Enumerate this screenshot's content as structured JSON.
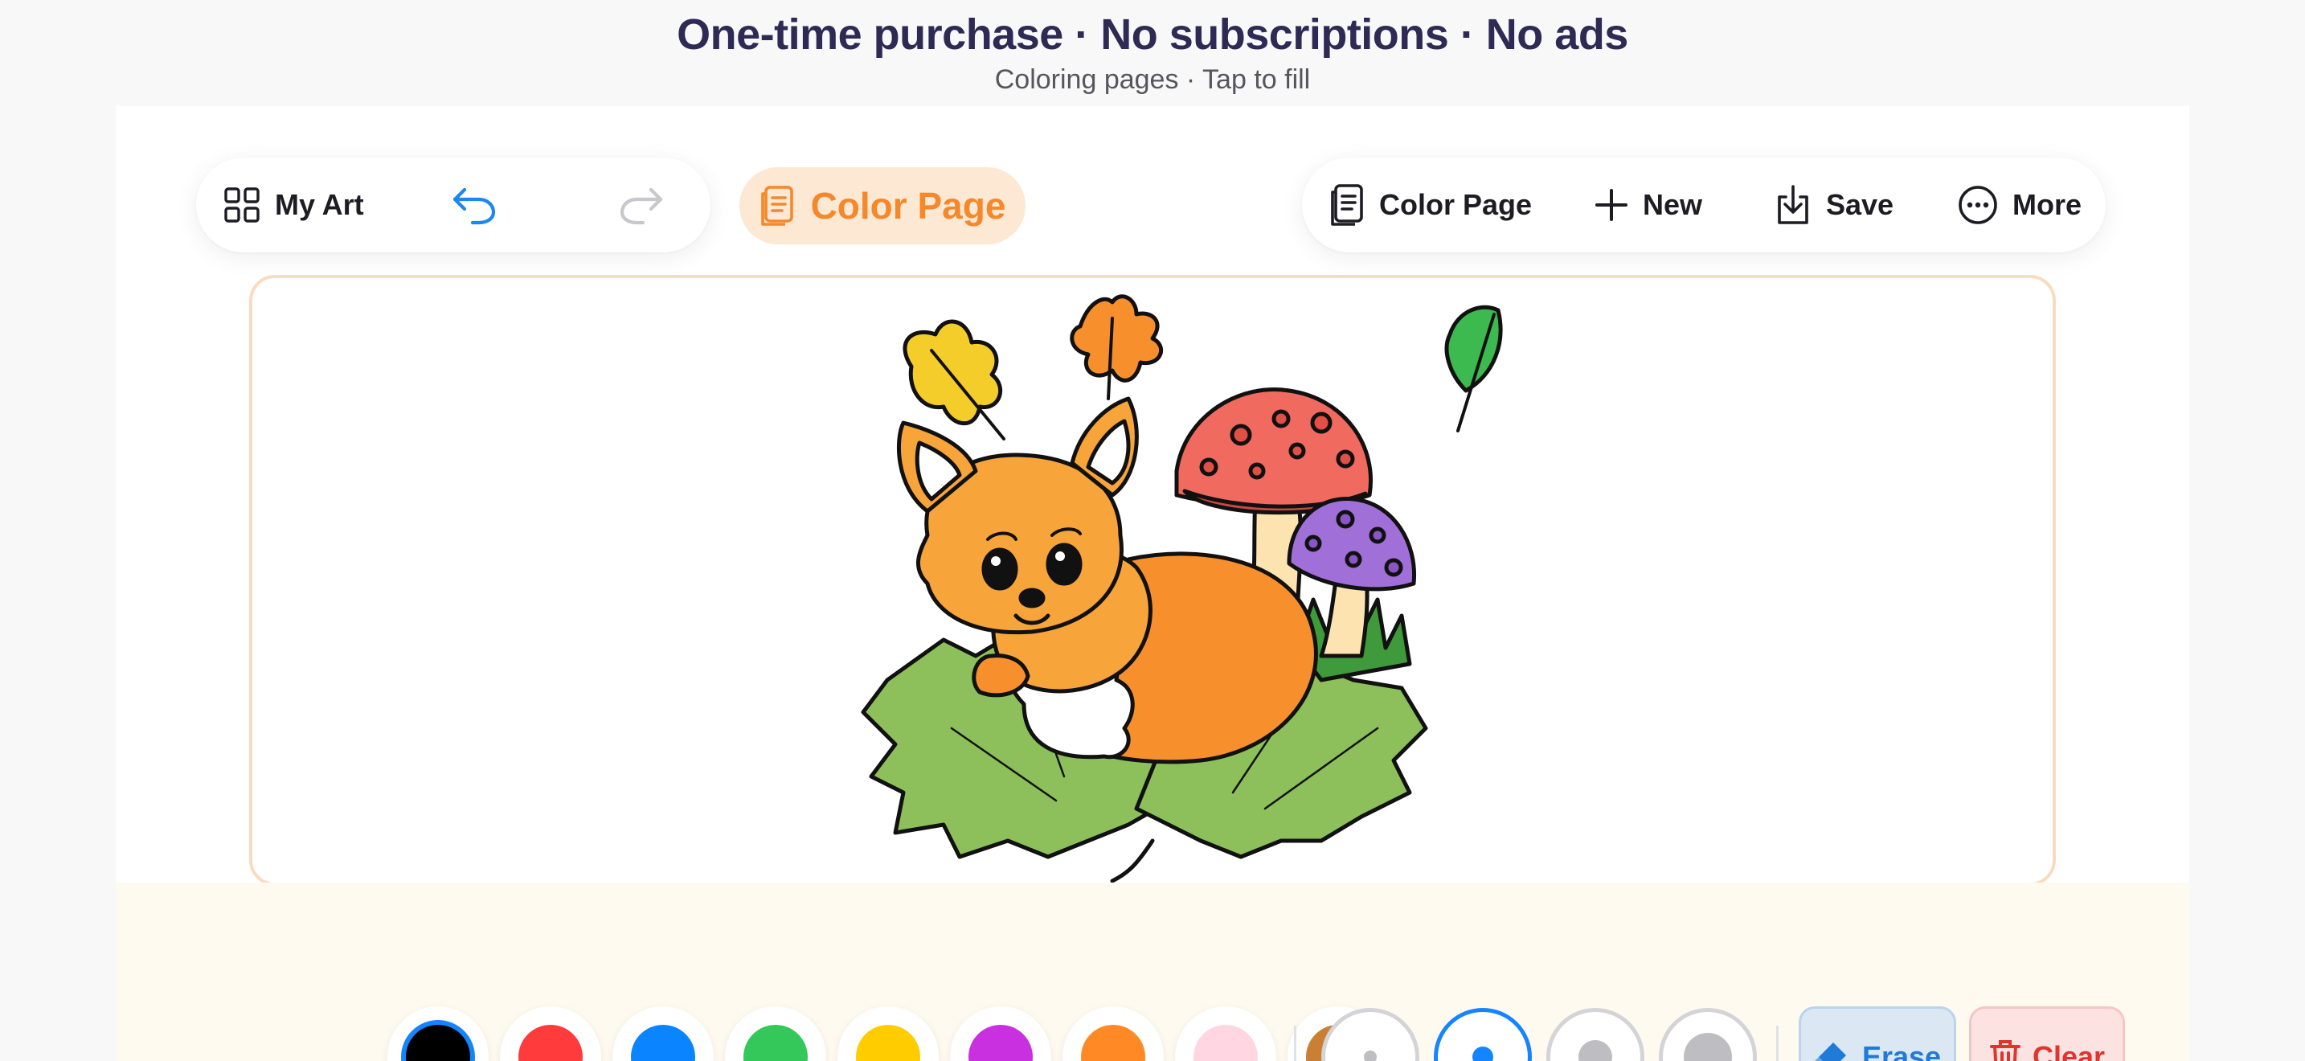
{
  "banner": {
    "title": "One-time purchase · No subscriptions · No ads",
    "subtitle": "Coloring pages · Tap to fill"
  },
  "toolbar": {
    "my_art_label": "My Art",
    "center_badge_label": "Color Page",
    "color_page_label": "Color Page",
    "new_label": "New",
    "save_label": "Save",
    "more_label": "More"
  },
  "canvas": {
    "page_name": "fox-with-mushrooms-and-autumn-leaves"
  },
  "palette": {
    "colors": [
      {
        "name": "black",
        "hex": "#000000",
        "selected": true
      },
      {
        "name": "red",
        "hex": "#ff3b3b",
        "selected": false
      },
      {
        "name": "blue",
        "hex": "#0a84ff",
        "selected": false
      },
      {
        "name": "green",
        "hex": "#34c759",
        "selected": false
      },
      {
        "name": "yellow",
        "hex": "#ffcc00",
        "selected": false
      },
      {
        "name": "purple",
        "hex": "#c930e0",
        "selected": false
      },
      {
        "name": "orange",
        "hex": "#ff8a25",
        "selected": false
      },
      {
        "name": "pink",
        "hex": "#ffd6e2",
        "selected": false
      },
      {
        "name": "brown",
        "hex": "#c98034",
        "selected": false
      }
    ],
    "brush_sizes": [
      "small",
      "medium",
      "large",
      "extra-large"
    ],
    "selected_brush_size": "medium"
  },
  "actions": {
    "erase_label": "Erase",
    "clear_label": "Clear"
  },
  "colors": {
    "accent": "#1584ff",
    "brand_orange": "#f5882a",
    "banner_text": "#2e2a55",
    "erase": "#1f7ad8",
    "clear": "#e0352e"
  }
}
